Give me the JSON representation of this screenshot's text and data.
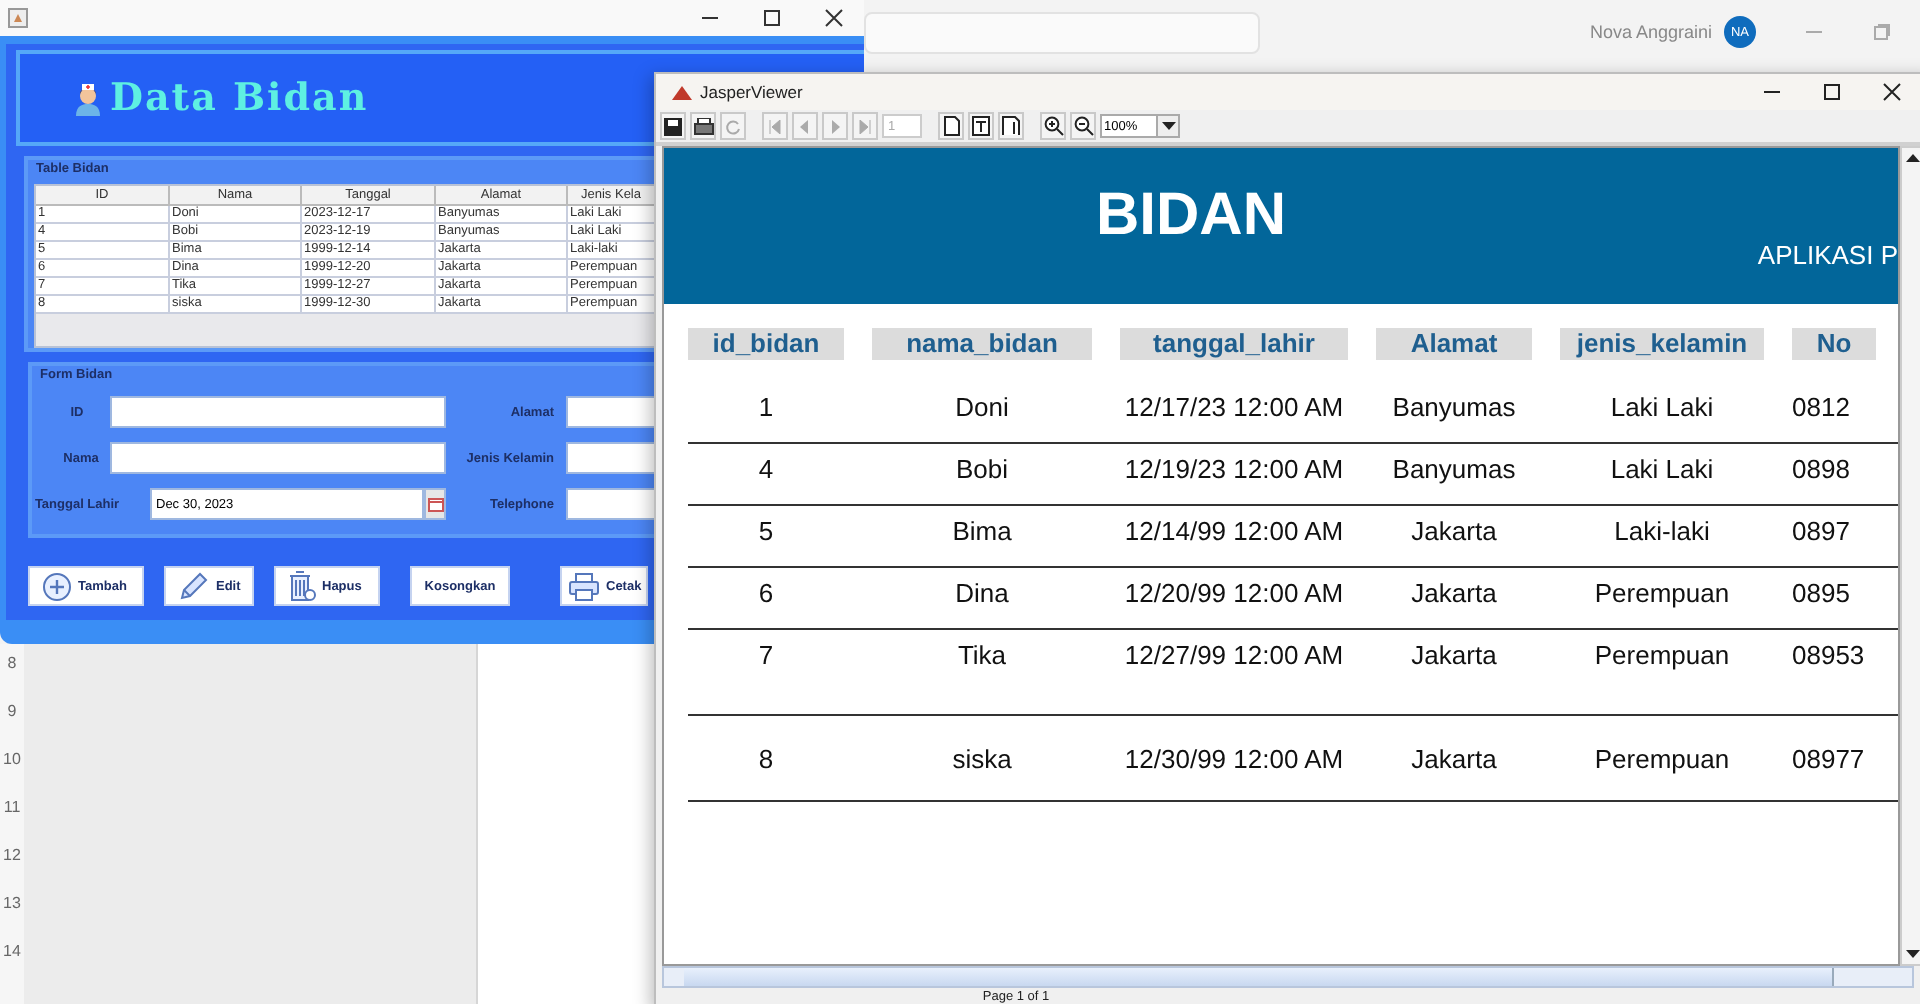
{
  "background_app": {
    "user_name": "Nova Anggraini",
    "avatar_initials": "NA",
    "ruler_marks": [
      "8",
      "9",
      "10",
      "11",
      "12",
      "13",
      "14"
    ]
  },
  "data_bidan_window": {
    "heading": "Data Bidan",
    "table": {
      "title": "Table Bidan",
      "columns": [
        "ID",
        "Nama",
        "Tanggal",
        "Alamat",
        "Jenis Kela"
      ],
      "rows": [
        [
          "1",
          "Doni",
          "2023-12-17",
          "Banyumas",
          "Laki Laki"
        ],
        [
          "4",
          "Bobi",
          "2023-12-19",
          "Banyumas",
          "Laki Laki"
        ],
        [
          "5",
          "Bima",
          "1999-12-14",
          "Jakarta",
          "Laki-laki"
        ],
        [
          "6",
          "Dina",
          "1999-12-20",
          "Jakarta",
          "Perempuan"
        ],
        [
          "7",
          "Tika",
          "1999-12-27",
          "Jakarta",
          "Perempuan"
        ],
        [
          "8",
          "siska",
          "1999-12-30",
          "Jakarta",
          "Perempuan"
        ]
      ]
    },
    "form": {
      "title": "Form Bidan",
      "fields": [
        {
          "label": "ID",
          "kind": "text"
        },
        {
          "label": "Alamat",
          "kind": "text"
        },
        {
          "label": "Nama",
          "kind": "text"
        },
        {
          "label": "Jenis Kelamin",
          "kind": "text"
        },
        {
          "label": "Tanggal Lahir",
          "kind": "date",
          "value": "Dec 30, 2023"
        },
        {
          "label": "Telephone",
          "kind": "text"
        }
      ]
    },
    "buttons": [
      {
        "label": "Tambah",
        "kind": "add"
      },
      {
        "label": "Edit",
        "kind": "edit"
      },
      {
        "label": "Hapus",
        "kind": "delete"
      },
      {
        "label": "Kosongkan",
        "kind": "clear"
      },
      {
        "label": "Cetak",
        "kind": "print"
      }
    ]
  },
  "jasper_viewer": {
    "title": "JasperViewer",
    "page_field": "1",
    "zoom": "100%",
    "report": {
      "title": "BIDAN",
      "subtitle": "APLIKASI P",
      "columns": [
        "id_bidan",
        "nama_bidan",
        "tanggal_lahir",
        "Alamat",
        "jenis_kelamin",
        "No"
      ],
      "rows": [
        [
          "1",
          "Doni",
          "12/17/23 12:00 AM",
          "Banyumas",
          "Laki Laki",
          "0812"
        ],
        [
          "4",
          "Bobi",
          "12/19/23 12:00 AM",
          "Banyumas",
          "Laki Laki",
          "0898"
        ],
        [
          "5",
          "Bima",
          "12/14/99 12:00 AM",
          "Jakarta",
          "Laki-laki",
          "0897"
        ],
        [
          "6",
          "Dina",
          "12/20/99 12:00 AM",
          "Jakarta",
          "Perempuan",
          "0895"
        ],
        [
          "7",
          "Tika",
          "12/27/99 12:00 AM",
          "Jakarta",
          "Perempuan",
          "08953"
        ],
        [
          "8",
          "siska",
          "12/30/99 12:00 AM",
          "Jakarta",
          "Perempuan",
          "08977"
        ]
      ]
    },
    "status": "Page 1 of 1"
  }
}
